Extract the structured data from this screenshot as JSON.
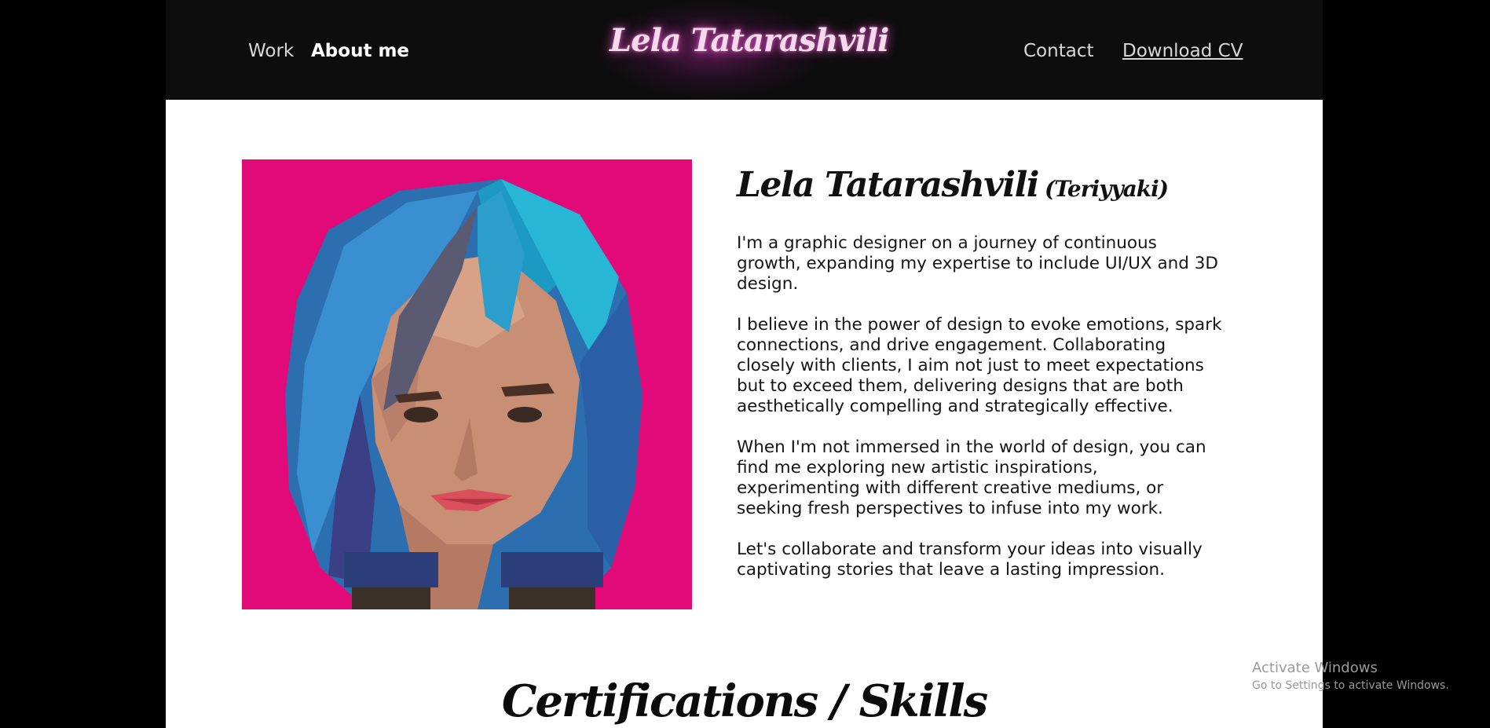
{
  "nav": {
    "work": "Work",
    "about": "About me",
    "contact": "Contact",
    "download_cv": "Download CV"
  },
  "logo": "Lela Tatarashvili",
  "intro": {
    "name": "Lela Tatarashvili",
    "nickname": "(Teriyyaki)",
    "paragraphs": [
      "I'm a graphic designer on a journey of continuous growth, expanding my expertise to include UI/UX and 3D design.",
      "I believe in the power of design to evoke emotions, spark connections, and drive engagement. Collaborating closely with clients, I aim not just to meet expectations but to exceed them, delivering designs that are both aesthetically compelling and strategically effective.",
      "When I'm not immersed in the world of design, you can find me exploring new artistic inspirations, experimenting with different creative mediums, or seeking fresh perspectives to infuse into my work.",
      "Let's collaborate and transform your ideas into visually captivating stories that leave a lasting impression."
    ]
  },
  "section_title": "Certifications / Skills",
  "watermark": {
    "title": "Activate Windows",
    "subtitle": "Go to Settings to activate Windows."
  },
  "colors": {
    "header_bg": "#0d0d0d",
    "portrait_bg": "#e20a78",
    "logo_glow": "#e650c8",
    "hair": "#2fb8d8"
  }
}
